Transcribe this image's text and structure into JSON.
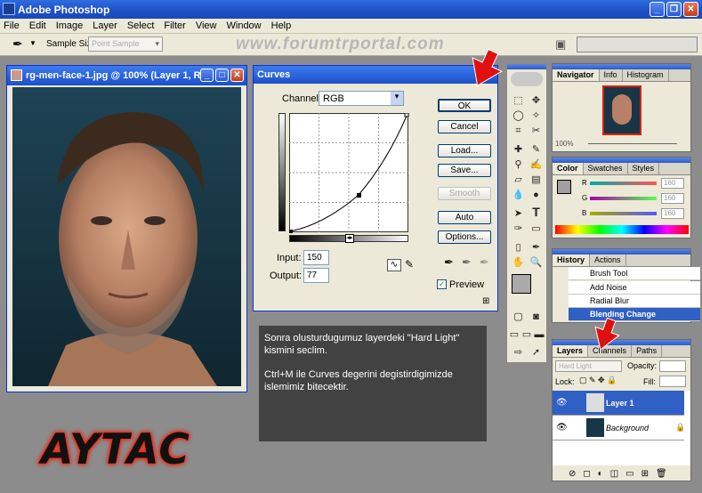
{
  "app": {
    "title": "Adobe Photoshop"
  },
  "menu": [
    "File",
    "Edit",
    "Image",
    "Layer",
    "Select",
    "Filter",
    "View",
    "Window",
    "Help"
  ],
  "options": {
    "sample_size_label": "Sample Size:",
    "sample_size_value": "Point Sample"
  },
  "watermark": "www.forumtrportal.com",
  "document": {
    "title": "rg-men-face-1.jpg @ 100% (Layer 1, R..."
  },
  "curves": {
    "title": "Curves",
    "channel_label": "Channel:",
    "channel_value": "RGB",
    "ok": "OK",
    "cancel": "Cancel",
    "load": "Load...",
    "save": "Save...",
    "smooth": "Smooth",
    "auto": "Auto",
    "options": "Options...",
    "input_label": "Input:",
    "input_value": "150",
    "output_label": "Output:",
    "output_value": "77",
    "preview_label": "Preview",
    "preview_checked": true
  },
  "navigator": {
    "tabs": [
      "Navigator",
      "Info",
      "Histogram"
    ],
    "zoom": "100%"
  },
  "color": {
    "tabs": [
      "Color",
      "Swatches",
      "Styles"
    ],
    "r_label": "R",
    "g_label": "G",
    "b_label": "B",
    "r": "160",
    "g": "160",
    "b": "160"
  },
  "history": {
    "tabs": [
      "History",
      "Actions"
    ],
    "items": [
      "Brush Tool",
      "Add Noise",
      "Radial Blur",
      "Blending Change"
    ]
  },
  "layers": {
    "tabs": [
      "Layers",
      "Channels",
      "Paths"
    ],
    "blend_mode": "Hard Light",
    "opacity_label": "Opacity:",
    "lock_label": "Lock:",
    "fill_label": "Fill:",
    "items": [
      "Layer 1",
      "Background"
    ]
  },
  "instructions": {
    "p1": "Sonra olusturdugumuz layerdeki \"Hard Light\" kismini seclim.",
    "p2": "Ctrl+M ile Curves degerini degistirdigimizde islemimiz bitecektir."
  },
  "logo": "AYTAC",
  "colors": {
    "accent": "#3160c4",
    "arrow": "#e01010"
  }
}
